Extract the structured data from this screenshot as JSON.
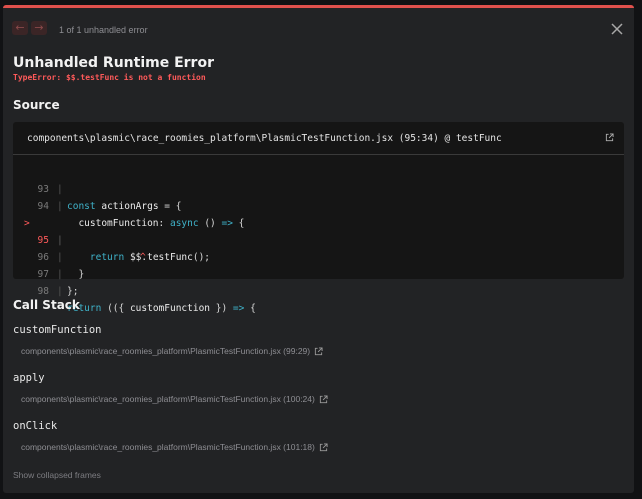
{
  "header": {
    "error_count": "1 of 1 unhandled error",
    "prev_icon": "arrow-left-icon",
    "next_icon": "arrow-right-icon",
    "close_icon": "close-icon"
  },
  "error": {
    "title": "Unhandled Runtime Error",
    "message": "TypeError: $$.testFunc is not a function"
  },
  "source": {
    "heading": "Source",
    "file": "components\\plasmic\\race_roomies_platform\\PlasmicTestFunction.jsx (95:34) @ testFunc",
    "lines": [
      {
        "num": "93",
        "code": "const actionArgs = {"
      },
      {
        "num": "94",
        "code": "  customFunction: async () => {"
      },
      {
        "num": "95",
        "code": "    return $$.testFunc();",
        "marker": ">"
      },
      {
        "num": "",
        "code": "^"
      },
      {
        "num": "96",
        "code": "  }"
      },
      {
        "num": "97",
        "code": "};"
      },
      {
        "num": "98",
        "code": "return (({ customFunction }) => {"
      }
    ]
  },
  "call_stack": {
    "heading": "Call Stack",
    "frames": [
      {
        "name": "customFunction",
        "location": "components\\plasmic\\race_roomies_platform\\PlasmicTestFunction.jsx (99:29)"
      },
      {
        "name": "apply",
        "location": "components\\plasmic\\race_roomies_platform\\PlasmicTestFunction.jsx (100:24)"
      },
      {
        "name": "onClick",
        "location": "components\\plasmic\\race_roomies_platform\\PlasmicTestFunction.jsx (101:18)"
      }
    ],
    "show_collapsed": "Show collapsed frames"
  },
  "colors": {
    "accent_red": "#e0514d",
    "error_text": "#ff5a5a",
    "keyword": "#3fb2c9"
  }
}
